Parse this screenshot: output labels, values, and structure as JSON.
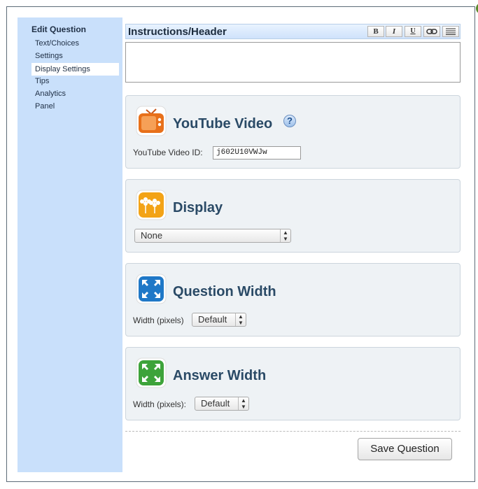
{
  "sidebar": {
    "title": "Edit Question",
    "items": [
      {
        "label": "Text/Choices"
      },
      {
        "label": "Settings"
      },
      {
        "label": "Display Settings",
        "active": true
      },
      {
        "label": "Tips"
      },
      {
        "label": "Analytics"
      },
      {
        "label": "Panel"
      }
    ]
  },
  "instructions": {
    "title": "Instructions/Header",
    "toolbar": {
      "bold": "B",
      "italic": "I",
      "underline": "U"
    },
    "value": ""
  },
  "youtube": {
    "title": "YouTube Video",
    "help": "?",
    "field_label": "YouTube Video ID:",
    "field_value": "j602U10VWJw"
  },
  "display": {
    "title": "Display",
    "select_value": "None"
  },
  "question_width": {
    "title": "Question Width",
    "field_label": "Width (pixels)",
    "select_value": "Default"
  },
  "answer_width": {
    "title": "Answer Width",
    "field_label": "Width (pixels):",
    "select_value": "Default"
  },
  "save_label": "Save Question",
  "colors": {
    "sidebar": "#c9e0fb",
    "panel": "#eef2f5",
    "title": "#2a4a66",
    "youtube_icon": "#e8701a",
    "display_icon": "#f3a316",
    "question_icon": "#1f78c7",
    "answer_icon": "#3da33a"
  }
}
